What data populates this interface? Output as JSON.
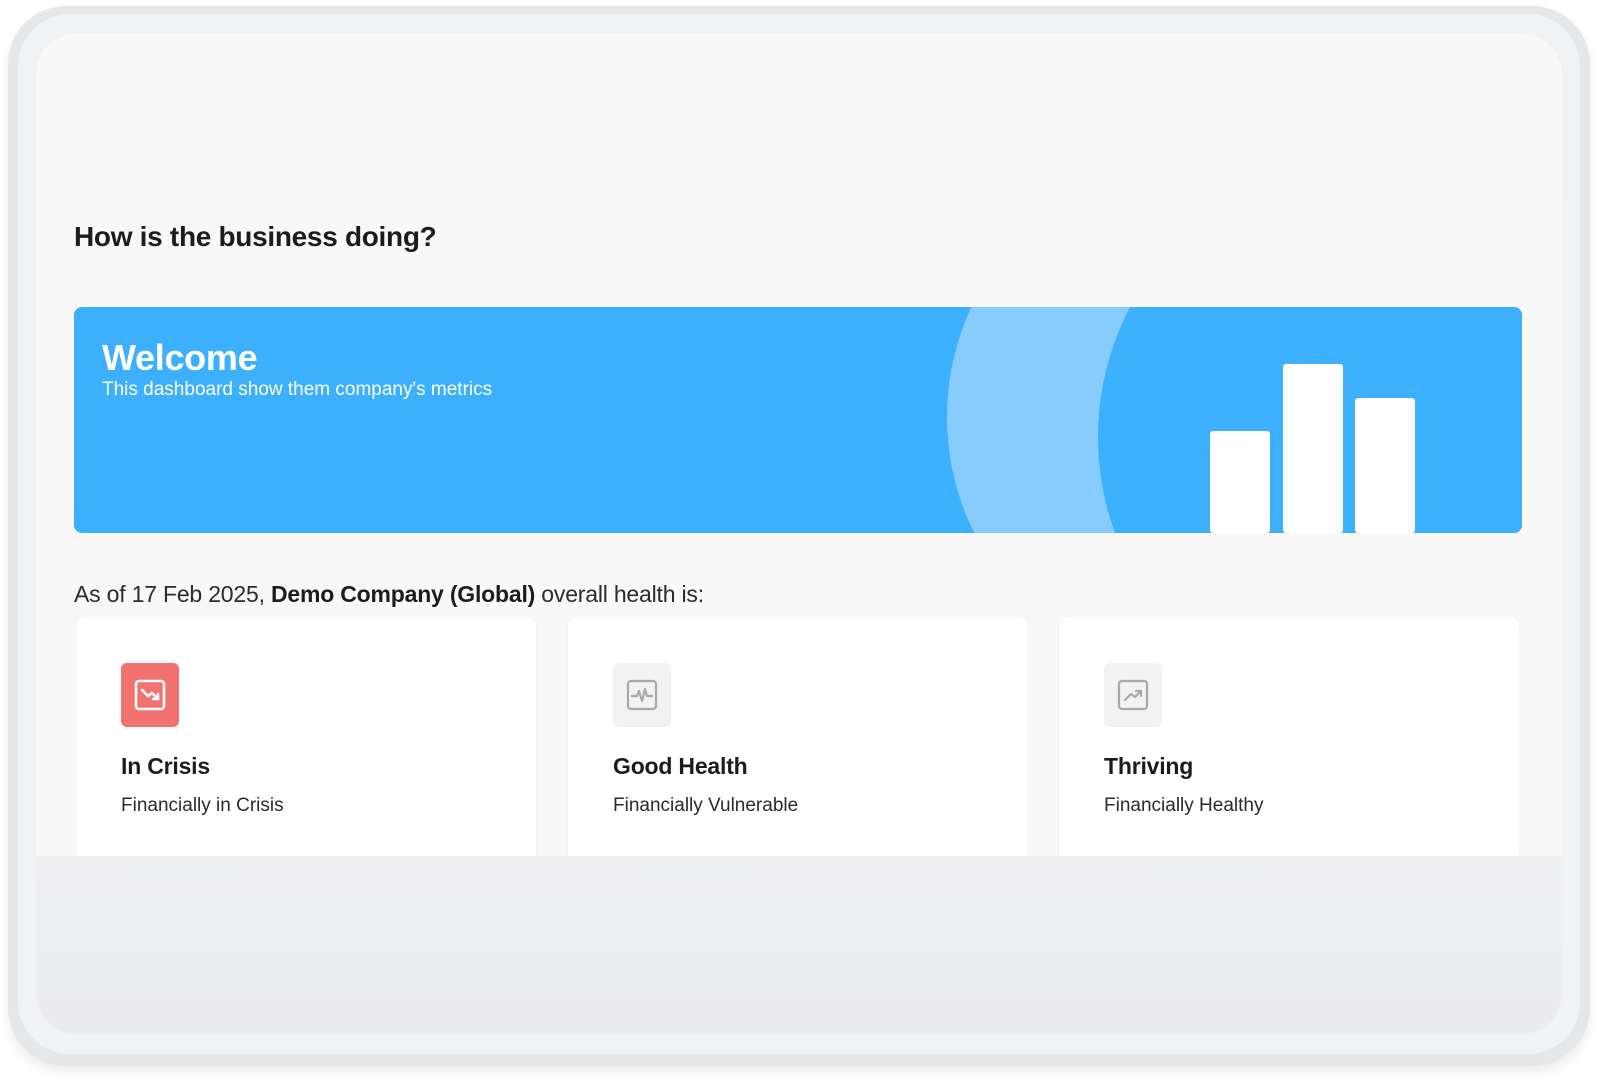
{
  "page": {
    "heading": "How is the business doing?"
  },
  "banner": {
    "title": "Welcome",
    "subtitle": "This dashboard show them company's metrics",
    "color": "#3cb0fd",
    "accent_color": "#86cdfe"
  },
  "health": {
    "prefix": "As of 17 Feb 2025, ",
    "company": "Demo Company (Global)",
    "suffix": " overall health is:"
  },
  "cards": [
    {
      "icon": "trending-down-icon",
      "title": "In Crisis",
      "subtitle": "Financially in Crisis",
      "active": true,
      "icon_color": "#f2726f"
    },
    {
      "icon": "pulse-icon",
      "title": "Good Health",
      "subtitle": "Financially Vulnerable",
      "active": false
    },
    {
      "icon": "trending-up-icon",
      "title": "Thriving",
      "subtitle": "Financially Healthy",
      "active": false
    }
  ]
}
